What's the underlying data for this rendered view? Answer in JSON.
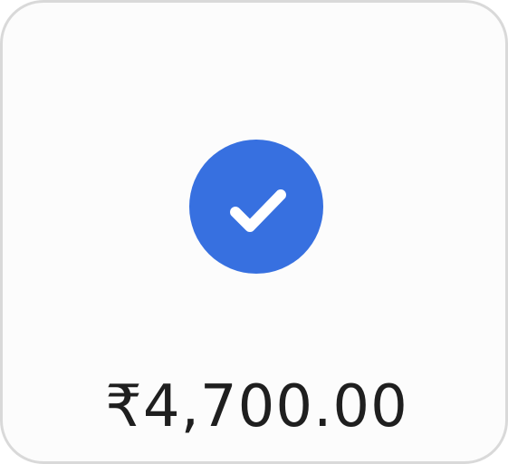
{
  "payment": {
    "status_icon": "check-icon",
    "amount": "₹4,700.00"
  },
  "colors": {
    "accent": "#3770e0",
    "background": "#fcfcfc",
    "border": "#d9d9d9",
    "text": "#1f1f1f"
  }
}
